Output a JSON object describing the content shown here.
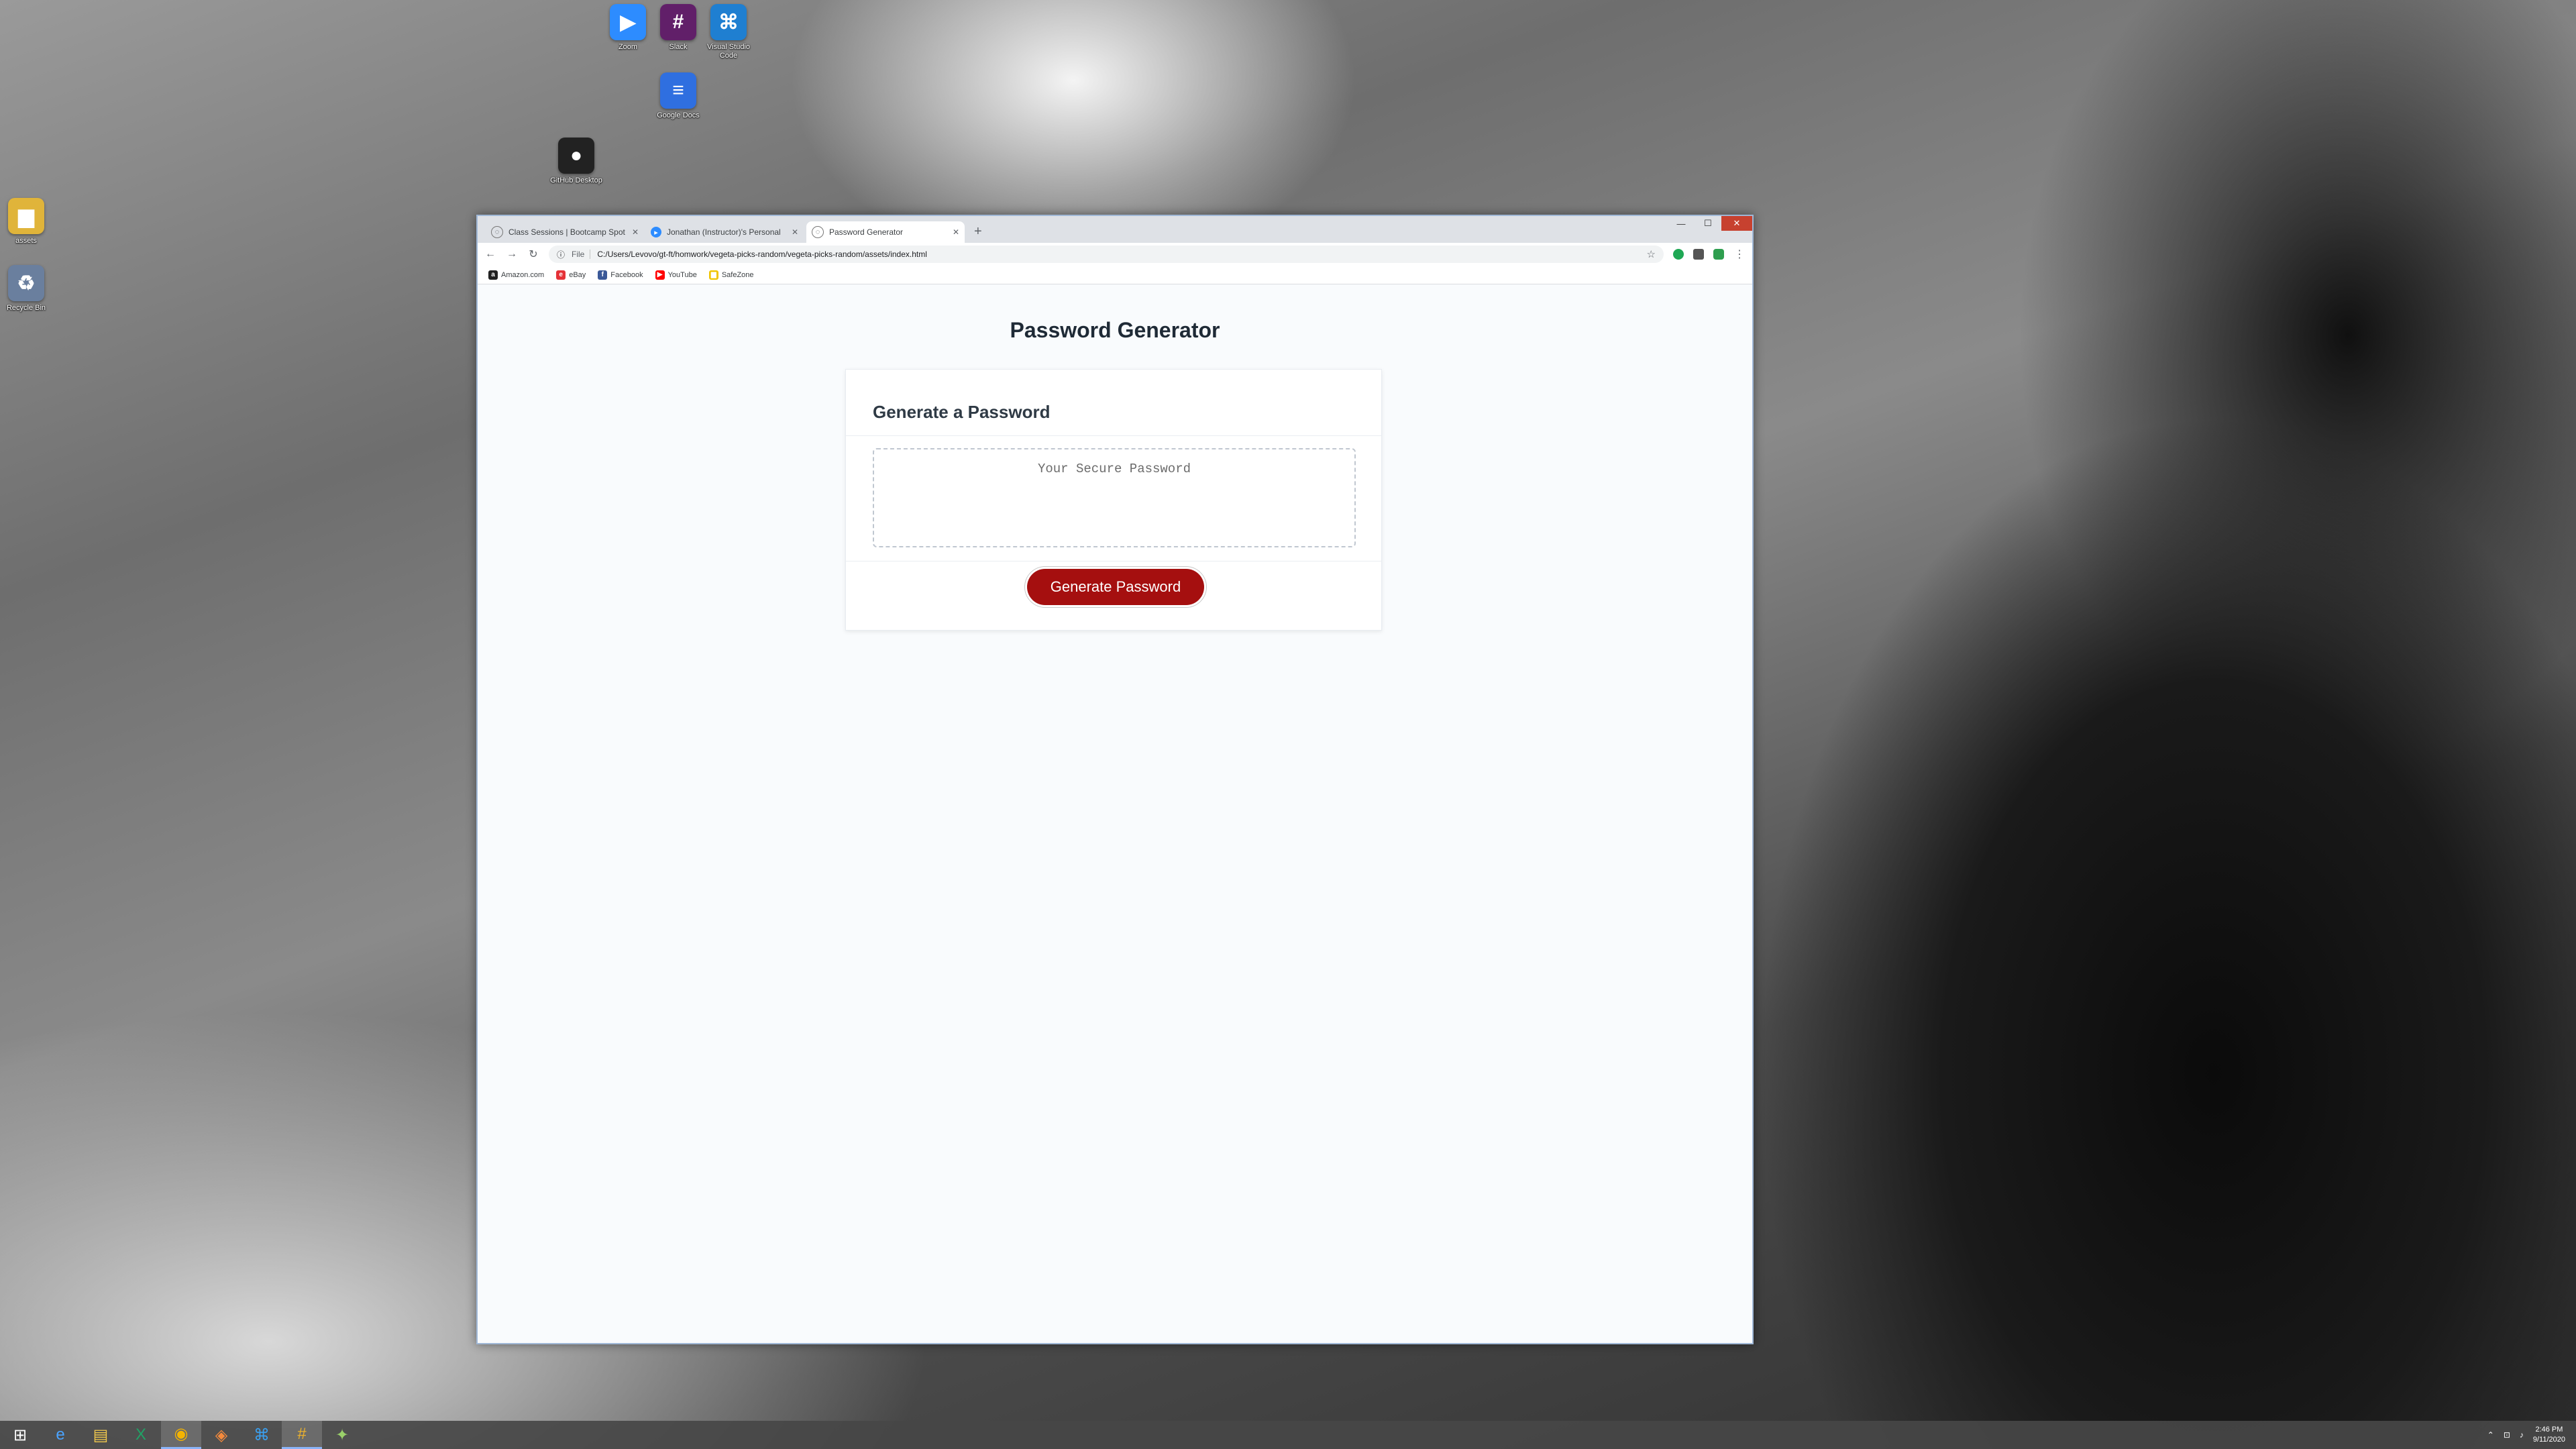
{
  "desktop": {
    "icons_left": [
      {
        "label": "Recycle Bin",
        "icon": "recycle-bin-icon",
        "color": "#6a7f9e"
      },
      {
        "label": "assets",
        "icon": "folder-icon",
        "color": "#e0b43a"
      }
    ],
    "icons_top": [
      {
        "label": "Zoom",
        "icon": "zoom-icon",
        "color": "#2d8cff"
      },
      {
        "label": "Slack",
        "icon": "slack-icon",
        "color": "#611f69"
      },
      {
        "label": "Visual Studio Code",
        "icon": "vscode-icon",
        "color": "#1f7fd1"
      },
      {
        "label": "GitHub Desktop",
        "icon": "github-icon",
        "color": "#222222"
      },
      {
        "label": "Google Docs",
        "icon": "docs-icon",
        "color": "#2f6fe0"
      }
    ]
  },
  "browser": {
    "tabs": [
      {
        "label": "Class Sessions | Bootcamp Spot",
        "active": false
      },
      {
        "label": "Jonathan (Instructor)'s Personal",
        "active": false
      },
      {
        "label": "Password Generator",
        "active": true
      }
    ],
    "new_tab_glyph": "+",
    "address": {
      "scheme": "File",
      "url": "C:/Users/Levovo/gt-ft/homwork/vegeta-picks-random/vegeta-picks-random/assets/index.html"
    },
    "bookmarks": [
      {
        "label": "Amazon.com",
        "color": "#222222",
        "glyph": "a"
      },
      {
        "label": "eBay",
        "color": "#e53238",
        "glyph": "e"
      },
      {
        "label": "Facebook",
        "color": "#3b5998",
        "glyph": "f"
      },
      {
        "label": "YouTube",
        "color": "#ff0000",
        "glyph": "▶"
      },
      {
        "label": "SafeZone",
        "color": "#f0c400",
        "glyph": "S"
      }
    ]
  },
  "page": {
    "title": "Password Generator",
    "card_title": "Generate a Password",
    "password_placeholder": "Your Secure Password",
    "password_value": "",
    "button_label": "Generate Password",
    "accent": "#a50f0f"
  },
  "taskbar": {
    "apps": [
      {
        "icon": "windows-start-icon",
        "glyph": "⊞"
      },
      {
        "icon": "internet-explorer-icon",
        "glyph": "e"
      },
      {
        "icon": "file-explorer-icon",
        "glyph": "▤"
      },
      {
        "icon": "excel-icon",
        "glyph": "X"
      },
      {
        "icon": "chrome-icon",
        "glyph": "◉"
      },
      {
        "icon": "brave-icon",
        "glyph": "◈"
      },
      {
        "icon": "vscode-icon",
        "glyph": "⌘"
      },
      {
        "icon": "slack-icon",
        "glyph": "#"
      },
      {
        "icon": "pinwheel-icon",
        "glyph": "✦"
      }
    ],
    "time": "2:46 PM",
    "date": "9/11/2020"
  }
}
